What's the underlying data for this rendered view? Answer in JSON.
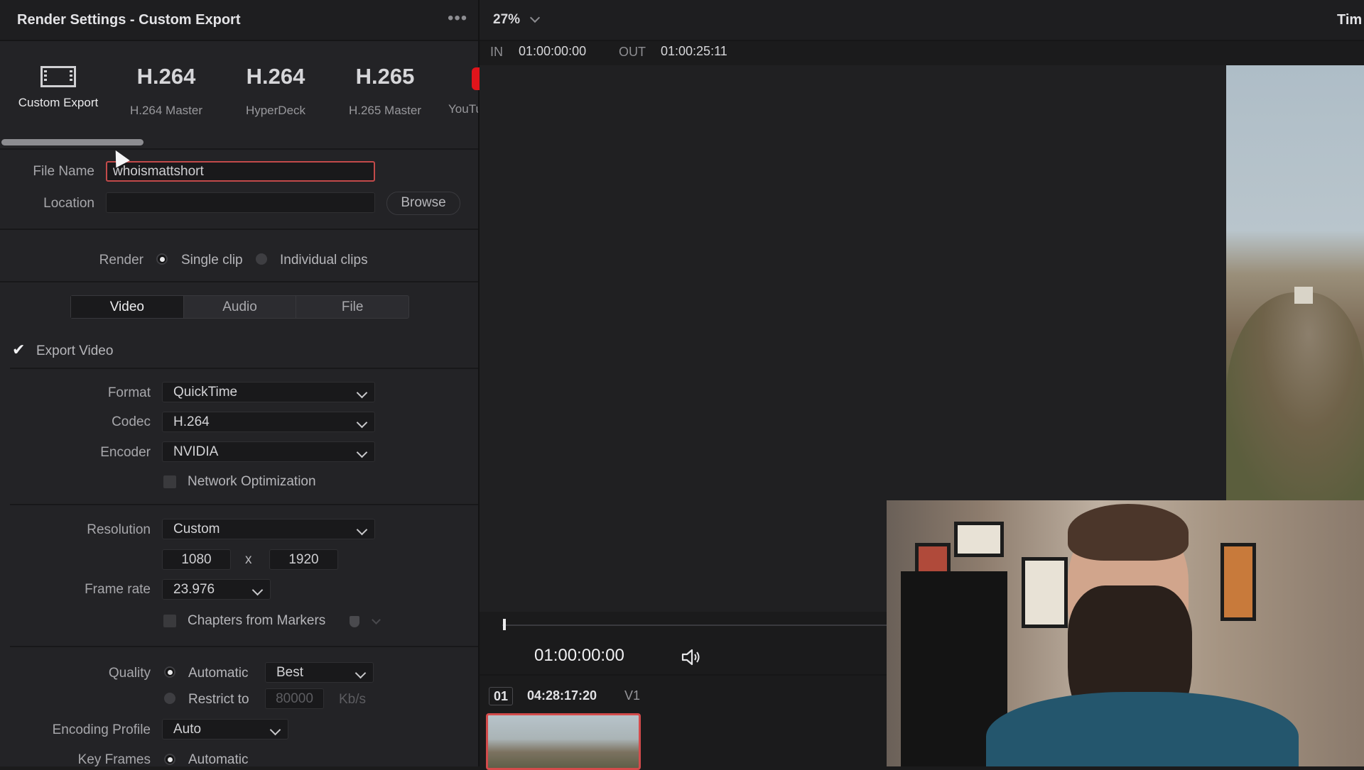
{
  "panel": {
    "title": "Render Settings - Custom Export",
    "more": "•••"
  },
  "presets": [
    {
      "big": "",
      "label": "Custom Export",
      "icon": "film-icon"
    },
    {
      "big": "H.264",
      "label": "H.264 Master"
    },
    {
      "big": "H.264",
      "label": "HyperDeck"
    },
    {
      "big": "H.265",
      "label": "H.265 Master"
    },
    {
      "big": "",
      "label": "YouTu"
    }
  ],
  "file": {
    "name_label": "File Name",
    "name_value": "whoismattshort",
    "location_label": "Location",
    "location_value": "",
    "browse": "Browse"
  },
  "render": {
    "label": "Render",
    "single": "Single clip",
    "individual": "Individual clips"
  },
  "tabs": [
    "Video",
    "Audio",
    "File"
  ],
  "export_video": "Export Video",
  "format": {
    "label": "Format",
    "value": "QuickTime"
  },
  "codec": {
    "label": "Codec",
    "value": "H.264"
  },
  "encoder": {
    "label": "Encoder",
    "value": "NVIDIA"
  },
  "network_opt": "Network Optimization",
  "resolution": {
    "label": "Resolution",
    "value": "Custom",
    "width": "1080",
    "x": "x",
    "height": "1920"
  },
  "frame_rate": {
    "label": "Frame rate",
    "value": "23.976"
  },
  "chapters": "Chapters from Markers",
  "quality": {
    "label": "Quality",
    "auto": "Automatic",
    "auto_value": "Best",
    "restrict": "Restrict to",
    "restrict_value": "80000",
    "unit": "Kb/s"
  },
  "encoding_profile": {
    "label": "Encoding Profile",
    "value": "Auto"
  },
  "key_frames": {
    "label": "Key Frames",
    "value": "Automatic"
  },
  "viewer": {
    "zoom": "27%",
    "title_partial": "Tim",
    "in_label": "IN",
    "in_value": "01:00:00:00",
    "out_label": "OUT",
    "out_value": "01:00:25:11",
    "timecode": "01:00:00:00"
  },
  "clip": {
    "number": "01",
    "timecode": "04:28:17:20",
    "track": "V1"
  },
  "colors": {
    "accent_red": "#d34b4b",
    "youtube_red": "#e0141b"
  }
}
